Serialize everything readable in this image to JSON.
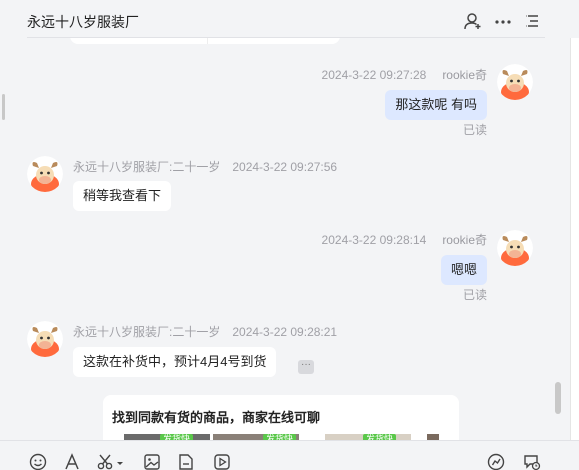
{
  "header": {
    "title": "永远十八岁服装厂"
  },
  "messages": [
    {
      "side": "out",
      "time": "2024-3-22 09:27:28",
      "name": "rookie奇",
      "text": "那这款呢 有吗",
      "read": "已读"
    },
    {
      "side": "in",
      "name": "永远十八岁服装厂:二十一岁",
      "time": "2024-3-22 09:27:56",
      "text": "稍等我查看下"
    },
    {
      "side": "out",
      "time": "2024-3-22 09:28:14",
      "name": "rookie奇",
      "text": "嗯嗯",
      "read": "已读"
    },
    {
      "side": "in",
      "name": "永远十八岁服装厂:二十一岁",
      "time": "2024-3-22 09:28:21",
      "text": "这款在补货中，预计4月4号到货",
      "more": "···"
    }
  ],
  "card": {
    "title": "找到同款有货的商品，商家在线可聊",
    "tags": [
      "发货快",
      "发货快",
      "发货快"
    ]
  },
  "icons": {
    "header": [
      "add-contact-icon",
      "more-icon",
      "list-icon"
    ],
    "toolbar": [
      "emoji-icon",
      "font-icon",
      "scissors-icon",
      "image-icon",
      "file-icon",
      "video-icon",
      "history-icon",
      "quick-reply-icon"
    ]
  },
  "colors": {
    "accent": "#ff6a3d",
    "bubble_out": "#dde8ff",
    "bubble_in": "#ffffff",
    "tag": "#5ac84a"
  }
}
